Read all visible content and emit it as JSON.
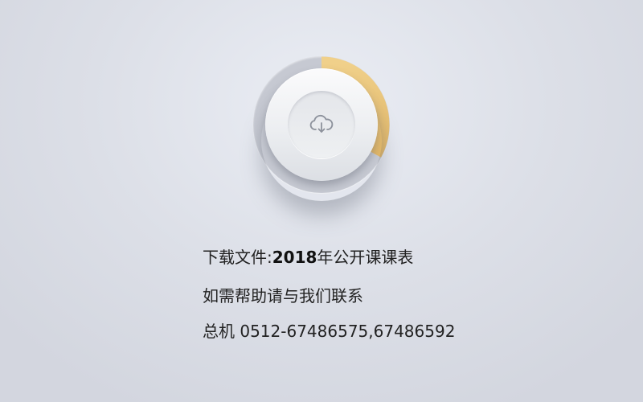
{
  "download": {
    "icon": "cloud-download-icon",
    "progress": 0.33,
    "progress_color": "#e8c37a"
  },
  "info": {
    "file_prefix": "下载文件:",
    "file_year": "2018",
    "file_suffix": "年公开课课表",
    "help_text": "如需帮助请与我们联系",
    "phone_text": "总机 0512-67486575,67486592"
  }
}
